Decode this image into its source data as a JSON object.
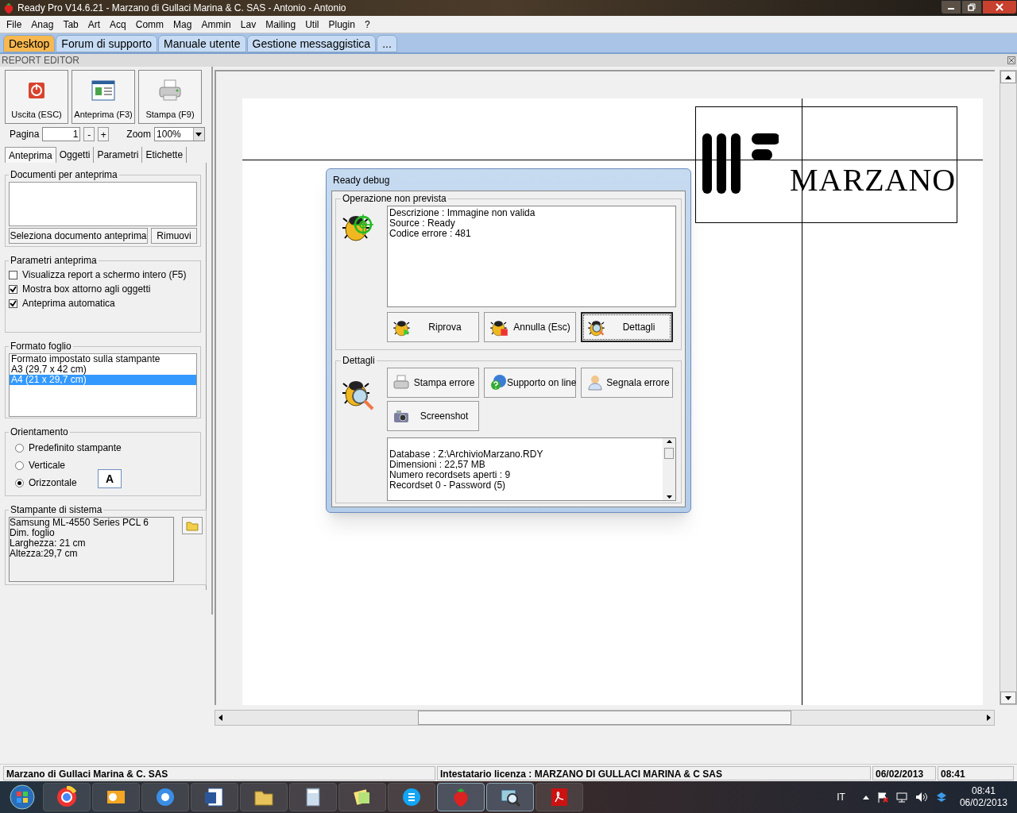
{
  "window": {
    "title": "Ready Pro V14.6.21 - Marzano di Gullaci Marina & C. SAS - Antonio - Antonio"
  },
  "menu": [
    "File",
    "Anag",
    "Tab",
    "Art",
    "Acq",
    "Comm",
    "Mag",
    "Ammin",
    "Lav",
    "Mailing",
    "Util",
    "Plugin",
    "?"
  ],
  "tabs": [
    {
      "label": "Desktop",
      "selected": true
    },
    {
      "label": "Forum di supporto",
      "selected": false
    },
    {
      "label": "Manuale utente",
      "selected": false
    },
    {
      "label": "Gestione messaggistica",
      "selected": false
    },
    {
      "label": "...",
      "selected": false
    }
  ],
  "section_title": "REPORT EDITOR",
  "toolbar": [
    "Uscita (ESC)",
    "Anteprima (F3)",
    "Stampa (F9)"
  ],
  "pager": {
    "label": "Pagina",
    "value": "1",
    "minus": "-",
    "plus": "+",
    "zoom_label": "Zoom",
    "zoom_value": "100%"
  },
  "panel_tabs": [
    {
      "label": "Anteprima",
      "selected": true
    },
    {
      "label": "Oggetti",
      "selected": false
    },
    {
      "label": "Parametri",
      "selected": false
    },
    {
      "label": "Etichette",
      "selected": false
    }
  ],
  "documents": {
    "title": "Documenti per anteprima",
    "buttons": [
      "Seleziona documento anteprima",
      "Rimuovi"
    ]
  },
  "preview_params": {
    "title": "Parametri anteprima",
    "options": [
      {
        "label": "Visualizza report a schermo intero (F5)",
        "checked": false
      },
      {
        "label": "Mostra box attorno agli oggetti",
        "checked": true
      },
      {
        "label": "Anteprima automatica",
        "checked": true
      }
    ]
  },
  "paper_format": {
    "title": "Formato foglio",
    "items": [
      {
        "label": "Formato impostato sulla stampante",
        "selected": false
      },
      {
        "label": "A3 (29,7 x 42 cm)",
        "selected": false
      },
      {
        "label": "A4 (21 x 29,7 cm)",
        "selected": true
      }
    ]
  },
  "orientation": {
    "title": "Orientamento",
    "preview_letter": "A",
    "options": [
      {
        "label": "Predefinito stampante",
        "selected": false
      },
      {
        "label": "Verticale",
        "selected": false
      },
      {
        "label": "Orizzontale",
        "selected": true
      }
    ]
  },
  "printer": {
    "title": "Stampante di sistema",
    "lines": [
      "Samsung ML-4550 Series PCL 6",
      "Dim. foglio",
      "Larghezza: 21 cm",
      "Altezza:29,7 cm"
    ]
  },
  "report": {
    "logo_text": "MARZANO"
  },
  "dialog": {
    "title": "Ready debug",
    "error_group": {
      "title": "Operazione non prevista",
      "lines": [
        "Descrizione : Immagine non valida",
        "Source : Ready",
        "Codice errore : 481"
      ],
      "buttons": [
        {
          "label": "Riprova",
          "focused": false
        },
        {
          "label": "Annulla (Esc)",
          "focused": false
        },
        {
          "label": "Dettagli",
          "focused": true
        }
      ]
    },
    "details_group": {
      "title": "Dettagli",
      "buttons": [
        "Stampa errore",
        "Supporto on line",
        "Segnala errore",
        "Screenshot"
      ],
      "lines": [
        "Database : Z:\\ArchivioMarzano.RDY",
        "Dimensioni : 22,57 MB",
        "Numero recordsets aperti : 9",
        "Recordset 0 - Password (5)"
      ]
    }
  },
  "status_bar": [
    "Marzano di Gullaci Marina & C. SAS",
    "Intestatario licenza : MARZANO DI GULLACI MARINA & C SAS",
    "06/02/2013",
    "08:41"
  ],
  "taskbar": {
    "language": "IT",
    "time": "08:41",
    "date": "06/02/2013"
  }
}
